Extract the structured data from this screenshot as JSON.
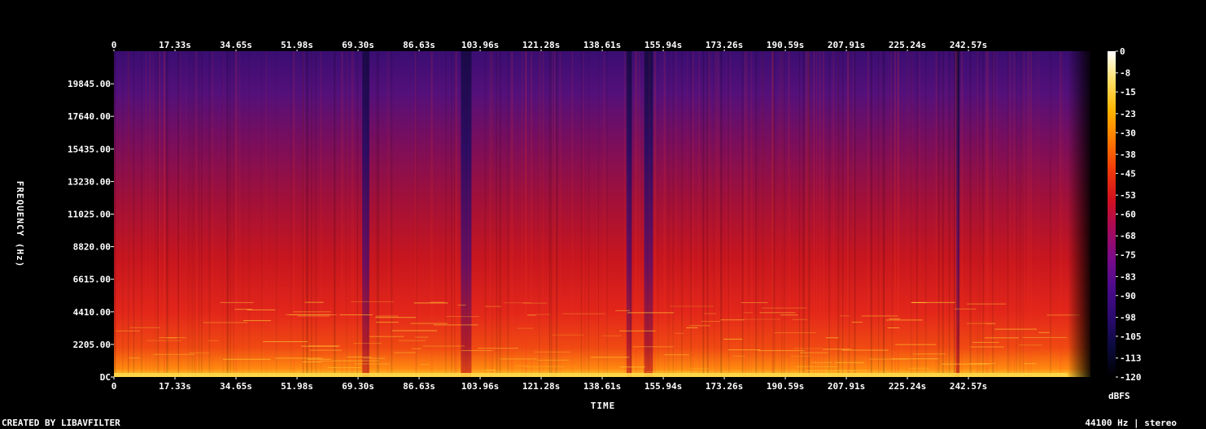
{
  "chart_data": {
    "type": "heatmap",
    "title": "",
    "xlabel": "TIME",
    "ylabel": "FREQUENCY (Hz)",
    "x_ticks": [
      "0",
      "17.33s",
      "34.65s",
      "51.98s",
      "69.30s",
      "86.63s",
      "103.96s",
      "121.28s",
      "138.61s",
      "155.94s",
      "173.26s",
      "190.59s",
      "207.91s",
      "225.24s",
      "242.57s"
    ],
    "x_tick_values": [
      0,
      17.33,
      34.65,
      51.98,
      69.3,
      86.63,
      103.96,
      121.28,
      138.61,
      155.94,
      173.26,
      190.59,
      207.91,
      225.24,
      242.57
    ],
    "xlim": [
      0,
      277.2
    ],
    "y_ticks": [
      "DC",
      "2205.00",
      "4410.00",
      "6615.00",
      "8820.00",
      "11025.00",
      "13230.00",
      "15435.00",
      "17640.00",
      "19845.00"
    ],
    "y_tick_values": [
      0,
      2205,
      4410,
      6615,
      8820,
      11025,
      13230,
      15435,
      17640,
      19845
    ],
    "ylim": [
      0,
      22050
    ],
    "colorbar": {
      "label": "dBFS",
      "ticks": [
        "0",
        "-8",
        "-15",
        "-23",
        "-30",
        "-38",
        "-45",
        "-53",
        "-60",
        "-68",
        "-75",
        "-83",
        "-90",
        "-98",
        "-105",
        "-113",
        "-120"
      ],
      "tick_values": [
        0,
        -8,
        -15,
        -23,
        -30,
        -38,
        -45,
        -53,
        -60,
        -68,
        -75,
        -83,
        -90,
        -98,
        -105,
        -113,
        -120
      ],
      "range": [
        -120,
        0
      ],
      "colormap": [
        "#000000",
        "#0a0a3c",
        "#2a0a6e",
        "#4b0a8c",
        "#7a0a8a",
        "#a80a5a",
        "#d4101e",
        "#f03a0a",
        "#ff7a00",
        "#ffb400",
        "#ffe066",
        "#ffffff"
      ]
    },
    "quiet_segments": [
      {
        "start": 70.5,
        "end": 72.5
      },
      {
        "start": 98.5,
        "end": 101.5
      },
      {
        "start": 145.5,
        "end": 147.0
      },
      {
        "start": 150.5,
        "end": 153.0
      },
      {
        "start": 239.0,
        "end": 240.0
      }
    ]
  },
  "footer": {
    "left": "CREATED BY LIBAVFILTER",
    "right": "44100 Hz | stereo"
  }
}
